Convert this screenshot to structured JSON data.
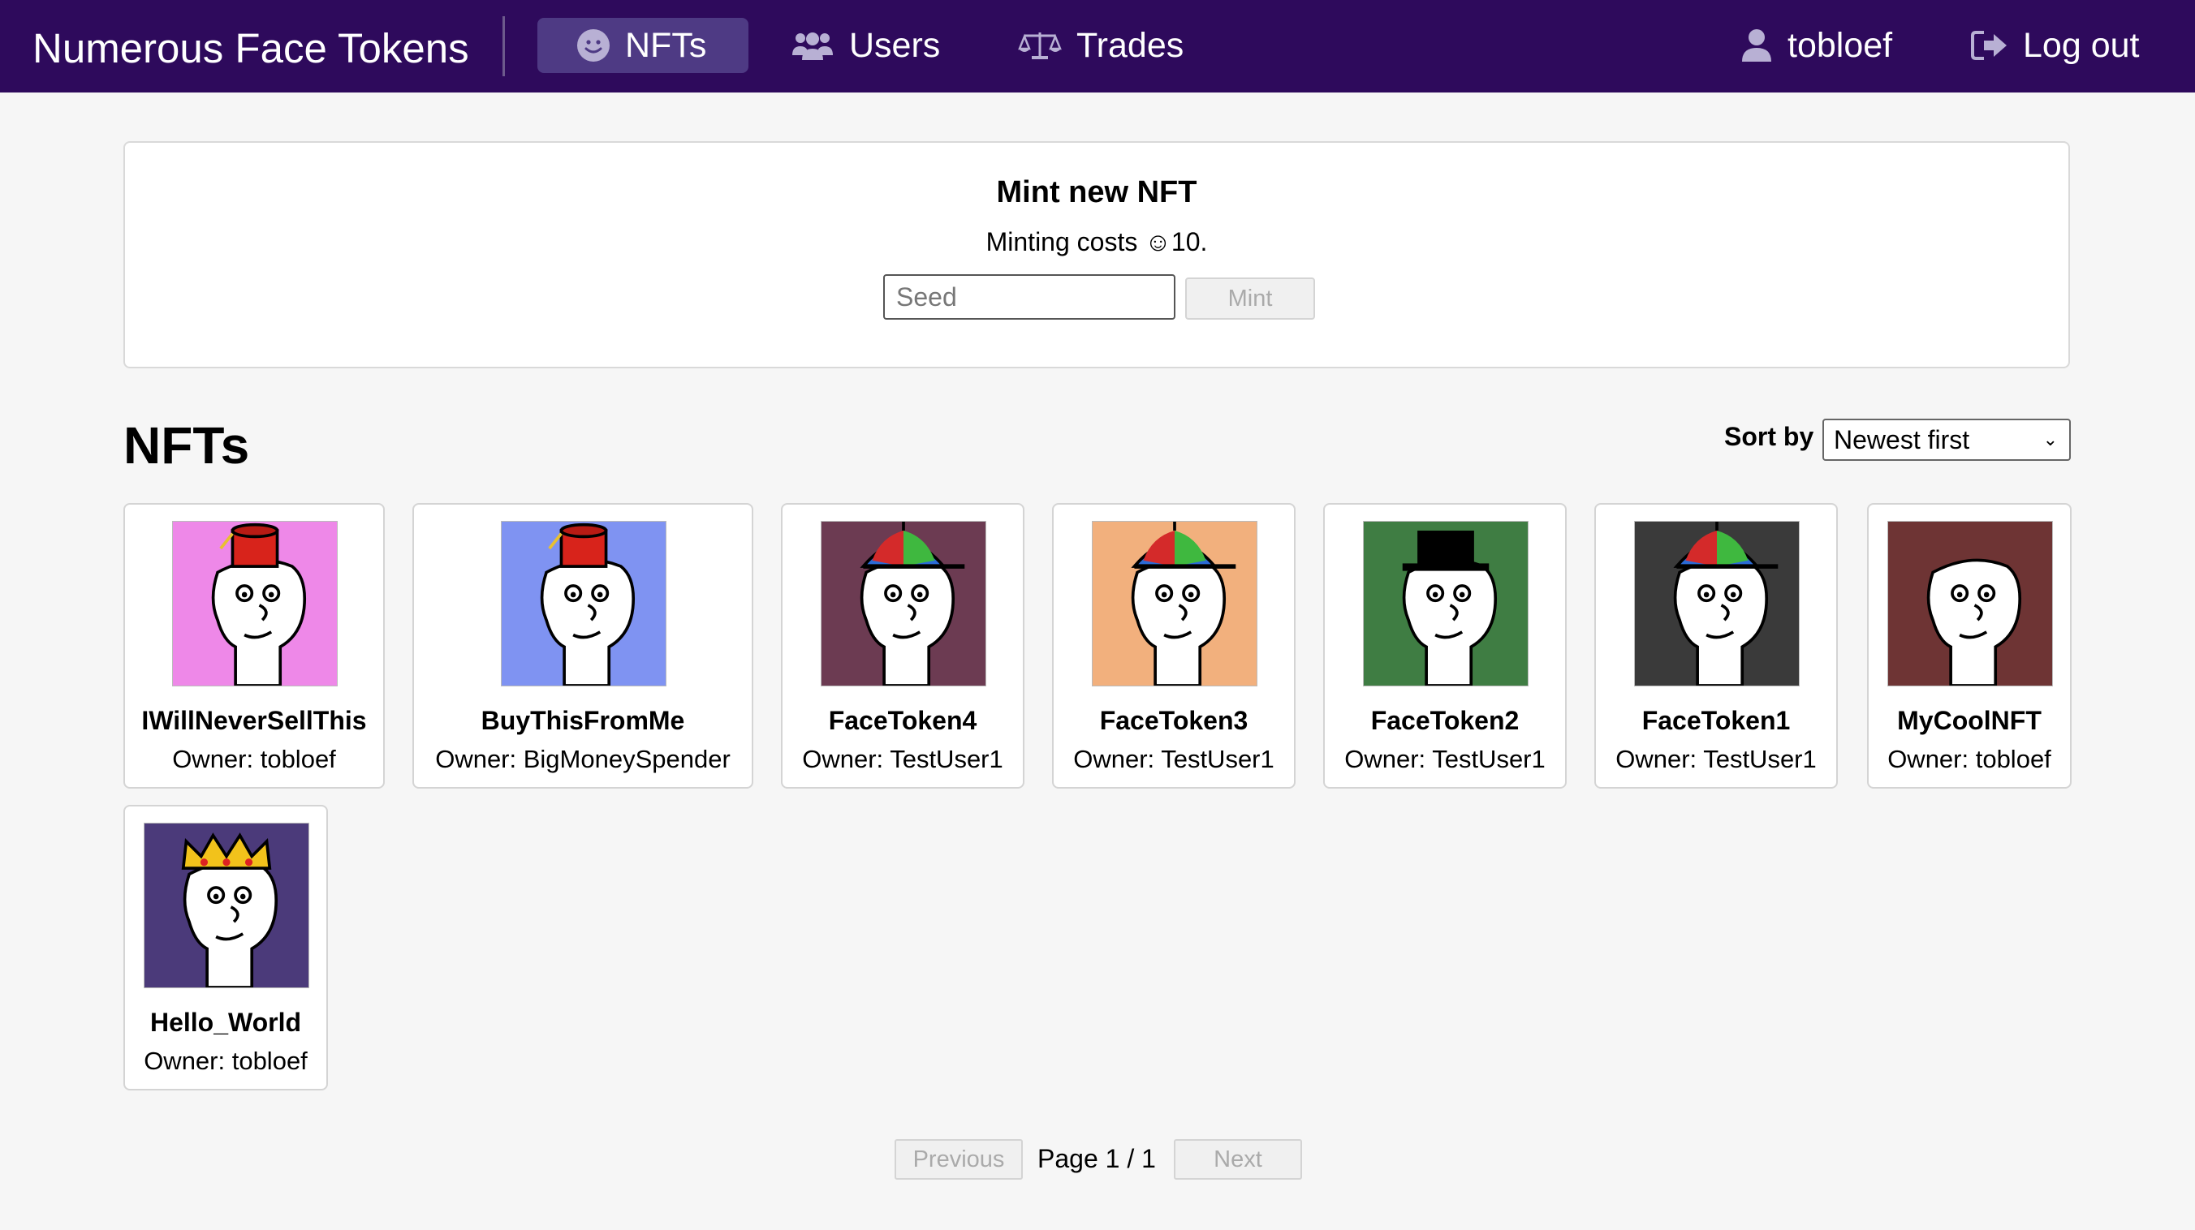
{
  "app": {
    "title": "Numerous Face Tokens"
  },
  "nav": {
    "items": [
      {
        "label": "NFTs",
        "icon": "smiley-icon",
        "active": true
      },
      {
        "label": "Users",
        "icon": "users-icon",
        "active": false
      },
      {
        "label": "Trades",
        "icon": "scales-icon",
        "active": false
      }
    ],
    "user": {
      "label": "tobloef",
      "icon": "user-icon"
    },
    "logout": {
      "label": "Log out",
      "icon": "logout-icon"
    }
  },
  "mint": {
    "title": "Mint new NFT",
    "cost_text": "Minting costs ☺10.",
    "seed_placeholder": "Seed",
    "seed_value": "",
    "button_label": "Mint"
  },
  "nfts_section": {
    "heading": "NFTs",
    "sort_label": "Sort by",
    "sort_selected": "Newest first"
  },
  "nfts": [
    {
      "name": "IWillNeverSellThis",
      "owner": "Owner: tobloef",
      "bg": "#ee88e8",
      "hat": "fez"
    },
    {
      "name": "BuyThisFromMe",
      "owner": "Owner: BigMoneySpender",
      "bg": "#7f93f2",
      "hat": "fez"
    },
    {
      "name": "FaceToken4",
      "owner": "Owner: TestUser1",
      "bg": "#6c3b52",
      "hat": "propeller"
    },
    {
      "name": "FaceToken3",
      "owner": "Owner: TestUser1",
      "bg": "#f2b07d",
      "hat": "propeller"
    },
    {
      "name": "FaceToken2",
      "owner": "Owner: TestUser1",
      "bg": "#3f7d43",
      "hat": "tophat"
    },
    {
      "name": "FaceToken1",
      "owner": "Owner: TestUser1",
      "bg": "#3a3a3a",
      "hat": "propeller"
    },
    {
      "name": "MyCoolNFT",
      "owner": "Owner: tobloef",
      "bg": "#6e3434",
      "hat": "none"
    },
    {
      "name": "Hello_World",
      "owner": "Owner: tobloef",
      "bg": "#4b3a7a",
      "hat": "crown"
    }
  ],
  "pagination": {
    "previous_label": "Previous",
    "page_text": "Page 1 / 1",
    "next_label": "Next"
  },
  "colors": {
    "nav_bg": "#2e0a5c",
    "nav_active_bg": "#4e3a84",
    "page_bg": "#f6f6f6"
  }
}
